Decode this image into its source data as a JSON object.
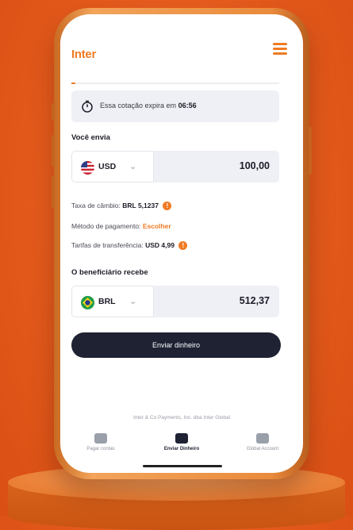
{
  "app": {
    "logo": "Inter"
  },
  "quote": {
    "text": "Essa cotação expira em",
    "timer": "06:56",
    "progress": 0.02
  },
  "sender": {
    "label": "Você envia",
    "currency": "USD",
    "amount": "100,00"
  },
  "details": {
    "exchange_label": "Taxa de câmbio:",
    "exchange_value": "BRL 5,1237",
    "payment_label": "Método de pagamento:",
    "payment_value": "Escolher",
    "fees_label": "Tarifas de transferência:",
    "fees_value": "USD 4,99",
    "info_icon": "info-icon"
  },
  "recipient": {
    "label": "O beneficiário recebe",
    "currency": "BRL",
    "amount": "512,37"
  },
  "actions": {
    "send_label": "Enviar dinheiro"
  },
  "footer": {
    "text": "Inter & Co Payments, Inc. dba Inter Global"
  },
  "tabs": [
    {
      "label": "Pagar contas",
      "icon": "bill-icon",
      "active": false
    },
    {
      "label": "Enviar Dinheiro",
      "icon": "send-money-icon",
      "active": true
    },
    {
      "label": "Global Account",
      "icon": "global-account-icon",
      "active": false
    }
  ],
  "colors": {
    "brand": "#f07b24",
    "button": "#1e2233",
    "background": "#e45a1c"
  }
}
